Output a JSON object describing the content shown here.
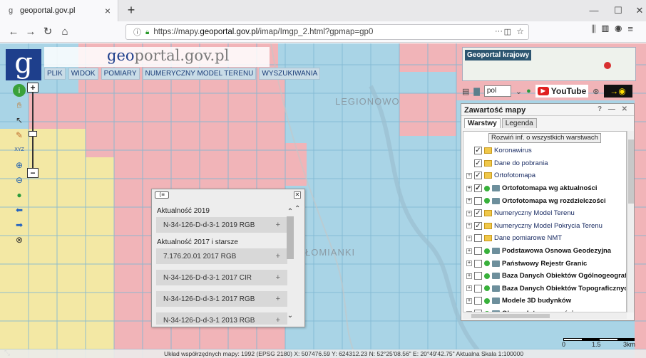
{
  "browser": {
    "tab_title": "geoportal.gov.pl",
    "tab_close": "×",
    "new_tab": "+",
    "url_prefix": "https://mapy.",
    "url_domain": "geoportal.gov.pl",
    "url_path": "/imap/Imgp_2.html?gpmap=gp0",
    "url_more": "···",
    "window_controls": {
      "minimize": "—",
      "maximize": "☐",
      "close": "✕"
    }
  },
  "header": {
    "logo_letter": "g",
    "brand_prefix": "geo",
    "brand_suffix": "portal.gov.pl",
    "menu": [
      "PLIK",
      "WIDOK",
      "POMIARY",
      "NUMERYCZNY MODEL TERENU",
      "WYSZUKIWANIA"
    ]
  },
  "map": {
    "places": [
      "LEGIONOWO",
      "ŁOMIANKI"
    ]
  },
  "overview": {
    "label": "Geoportal krajowy"
  },
  "toolbar_right": {
    "language": "pol",
    "youtube": "YouTube"
  },
  "layers_panel": {
    "title": "Zawartość mapy",
    "controls": "? — ✕",
    "tabs": [
      "Warstwy",
      "Legenda"
    ],
    "expand_button": "Rozwiń inf. o wszystkich warstwach",
    "layers": [
      {
        "label": "Koronawirus",
        "checked": true,
        "kind": "folder",
        "bold": false,
        "expander": false
      },
      {
        "label": "Dane do pobrania",
        "checked": true,
        "kind": "folder",
        "bold": false,
        "expander": false
      },
      {
        "label": "Ortofotomapa",
        "checked": true,
        "kind": "folder",
        "bold": false,
        "expander": true
      },
      {
        "label": "Ortofotomapa wg aktualności",
        "checked": true,
        "kind": "wms",
        "bold": true,
        "expander": true
      },
      {
        "label": "Ortofotomapa wg rozdzielczości",
        "checked": false,
        "kind": "wms",
        "bold": true,
        "expander": true
      },
      {
        "label": "Numeryczny Model Terenu",
        "checked": true,
        "kind": "folder",
        "bold": false,
        "expander": true
      },
      {
        "label": "Numeryczny Model Pokrycia Terenu",
        "checked": true,
        "kind": "folder",
        "bold": false,
        "expander": true
      },
      {
        "label": "Dane pomiarowe NMT",
        "checked": false,
        "kind": "folder",
        "bold": false,
        "expander": true
      },
      {
        "label": "Podstawowa Osnowa Geodezyjna",
        "checked": false,
        "kind": "wms",
        "bold": true,
        "expander": true
      },
      {
        "label": "Państwowy Rejestr Granic",
        "checked": false,
        "kind": "wms",
        "bold": true,
        "expander": true
      },
      {
        "label": "Baza Danych Obiektów Ogólnogeograficzny",
        "checked": false,
        "kind": "wms",
        "bold": true,
        "expander": true
      },
      {
        "label": "Baza Danych Obiektów Topograficznych",
        "checked": false,
        "kind": "wms",
        "bold": true,
        "expander": true
      },
      {
        "label": "Modele 3D budynków",
        "checked": false,
        "kind": "wms",
        "bold": true,
        "expander": true
      },
      {
        "label": "Obrazy Intensywności",
        "checked": false,
        "kind": "wms",
        "bold": true,
        "expander": true
      }
    ]
  },
  "popup": {
    "groups": [
      {
        "title": "Aktualność 2019",
        "items": [
          "N-34-126-D-d-3-1 2019 RGB"
        ]
      },
      {
        "title": "Aktualność 2017 i starsze",
        "items": [
          "7.176.20.01 2017 RGB",
          "N-34-126-D-d-3-1 2017 CIR",
          "N-34-126-D-d-3-1 2017 RGB",
          "N-34-126-D-d-3-1 2013 RGB"
        ]
      }
    ]
  },
  "scale": {
    "labels": [
      "0",
      "1.5",
      "3km"
    ]
  },
  "status": {
    "text": "Układ współrzędnych mapy: 1992 (EPSG 2180)  X: 507476.59 Y: 624312.23  N: 52°25'08.56\" E: 20°49'42.75\"  Aktualna Skala 1:100000"
  },
  "colors": {
    "red_zone": "#f1b4b8",
    "blue_zone": "#a9d4e6",
    "yellow_zone": "#f3e8a4",
    "grid": "#7fb7d3"
  }
}
